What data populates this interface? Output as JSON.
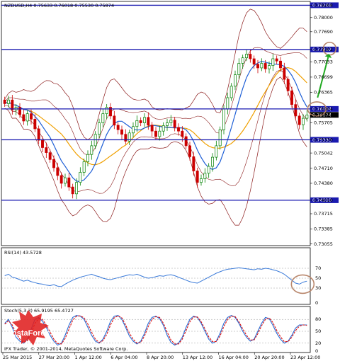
{
  "chart_data": {
    "type": "candlestick",
    "symbol_header": "NZDUSD,H4  0.75633 0.76018 0.75530 0.75874",
    "price_axis": {
      "ticks": [
        "0.78268",
        "0.78000",
        "0.77690",
        "0.77302",
        "0.77033",
        "0.76699",
        "0.76365",
        "0.76004",
        "0.75874",
        "0.75705",
        "0.75330",
        "0.75042",
        "0.74710",
        "0.74380",
        "0.74010",
        "0.73715",
        "0.73385",
        "0.73055"
      ],
      "range": [
        0.7305,
        0.7829
      ]
    },
    "horizontal_levels": [
      {
        "label": "0.78268",
        "value": 0.78268,
        "color": "#1a1ab0"
      },
      {
        "label": "0.77302",
        "value": 0.77302,
        "color": "#1a1ab0"
      },
      {
        "label": "0.76004",
        "value": 0.76004,
        "color": "#1a1ab0"
      },
      {
        "label": "0.75330",
        "value": 0.7533,
        "color": "#1a1ab0"
      },
      {
        "label": "0.74010",
        "value": 0.7401,
        "color": "#1a1ab0"
      }
    ],
    "current_price": {
      "label": "0.75874",
      "value": 0.75874
    },
    "x_labels": [
      "25 Mar 2015",
      "27 Mar 20:00",
      "1 Apr 12:00",
      "6 Apr 04:00",
      "8 Apr 20:00",
      "13 Apr 12:00",
      "16 Apr 04:00",
      "20 Apr 20:00",
      "23 Apr 12:00"
    ],
    "closes": [
      0.7612,
      0.762,
      0.7598,
      0.7604,
      0.7588,
      0.7574,
      0.759,
      0.7578,
      0.7557,
      0.7532,
      0.7516,
      0.7505,
      0.749,
      0.7472,
      0.7455,
      0.7438,
      0.745,
      0.743,
      0.7415,
      0.744,
      0.7462,
      0.7485,
      0.7501,
      0.752,
      0.7545,
      0.757,
      0.759,
      0.7604,
      0.7585,
      0.7565,
      0.7555,
      0.7545,
      0.753,
      0.7548,
      0.7562,
      0.7575,
      0.757,
      0.7582,
      0.7565,
      0.7552,
      0.754,
      0.7552,
      0.7564,
      0.757,
      0.7576,
      0.756,
      0.7552,
      0.754,
      0.752,
      0.7496,
      0.7465,
      0.744,
      0.7448,
      0.746,
      0.7475,
      0.7495,
      0.752,
      0.7555,
      0.76,
      0.7625,
      0.765,
      0.7675,
      0.77,
      0.7712,
      0.772,
      0.771,
      0.7698,
      0.769,
      0.77,
      0.7688,
      0.7695,
      0.771,
      0.7705,
      0.769,
      0.7665,
      0.764,
      0.761,
      0.7585,
      0.7566,
      0.758,
      0.7587
    ],
    "arrow_target": 0.7732,
    "rsi": {
      "label": "RSI(14) 43.5728",
      "levels": [
        "70",
        "50",
        "30",
        "0"
      ],
      "values": [
        55,
        58,
        52,
        50,
        47,
        44,
        46,
        43,
        41,
        39,
        38,
        36,
        35,
        37,
        34,
        33,
        38,
        42,
        46,
        49,
        52,
        54,
        56,
        58,
        55,
        53,
        50,
        48,
        47,
        49,
        51,
        53,
        55,
        57,
        56,
        58,
        55,
        52,
        50,
        51,
        53,
        55,
        54,
        56,
        57,
        55,
        52,
        49,
        46,
        43,
        41,
        40,
        44,
        48,
        52,
        56,
        60,
        63,
        66,
        68,
        69,
        70,
        71,
        70,
        69,
        68,
        67,
        69,
        68,
        70,
        69,
        67,
        65,
        62,
        58,
        52,
        46,
        40,
        38,
        42,
        44
      ]
    },
    "stoch": {
      "label": "Stoch(5,3,3) 65.9195 65.4727",
      "levels": [
        "80",
        "50",
        "20",
        "0"
      ],
      "main": [
        70,
        80,
        60,
        35,
        25,
        20,
        30,
        55,
        80,
        85,
        75,
        60,
        40,
        25,
        15,
        20,
        40,
        65,
        85,
        90,
        88,
        80,
        60,
        40,
        25,
        20,
        30,
        50,
        75,
        88,
        90,
        80,
        60,
        38,
        25,
        18,
        25,
        45,
        70,
        85,
        88,
        82,
        65,
        40,
        22,
        15,
        20,
        35,
        60,
        80,
        88,
        85,
        70,
        50,
        30,
        20,
        25,
        45,
        70,
        85,
        90,
        85,
        70,
        50,
        35,
        25,
        30,
        50,
        70,
        85,
        82,
        65,
        45,
        30,
        20,
        25,
        40,
        58,
        66,
        66,
        66
      ],
      "signal": [
        68,
        76,
        66,
        45,
        30,
        22,
        26,
        45,
        70,
        82,
        80,
        66,
        48,
        30,
        19,
        18,
        32,
        55,
        78,
        88,
        89,
        84,
        68,
        48,
        30,
        22,
        26,
        42,
        66,
        84,
        89,
        84,
        66,
        45,
        30,
        20,
        22,
        38,
        62,
        80,
        87,
        85,
        70,
        48,
        28,
        18,
        18,
        30,
        52,
        74,
        86,
        86,
        74,
        56,
        36,
        24,
        24,
        38,
        62,
        80,
        88,
        87,
        74,
        56,
        40,
        28,
        28,
        44,
        64,
        80,
        84,
        72,
        52,
        36,
        24,
        24,
        35,
        52,
        63,
        66,
        65
      ]
    },
    "footer": "IFX Trader, © 2001-2014, MetaQuotes Software Corp.",
    "logo": "InstaForex"
  },
  "colors": {
    "level_line": "#1a1ab0",
    "bull": "#008000",
    "bear": "#cc0000",
    "bollinger": "#8b1a1a",
    "ma_fast": "#1e5fd6",
    "ma_slow": "#f0a000",
    "rsi_line": "#3a7ad9",
    "stoch_main": "#2a6dd6",
    "stoch_signal": "#dd1111",
    "circle": "#b8866b",
    "arrow": "#22aa22"
  }
}
